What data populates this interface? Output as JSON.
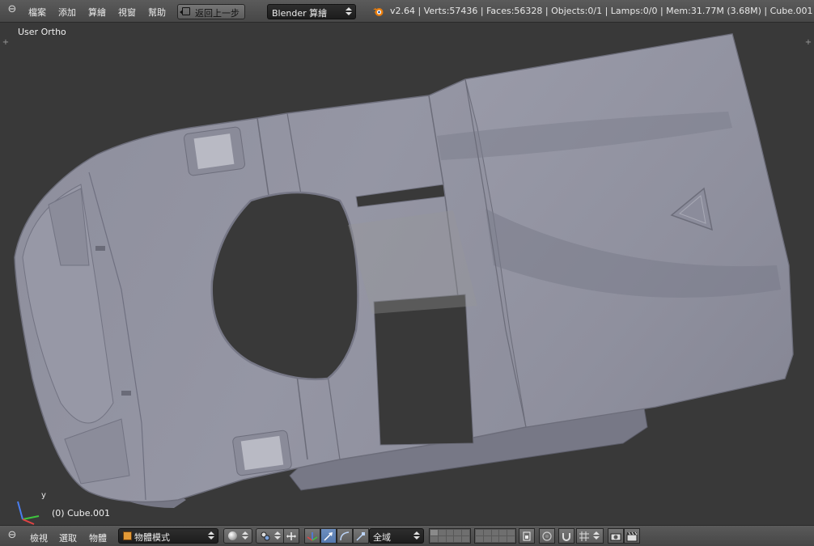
{
  "top_header": {
    "menu": [
      "檔案",
      "添加",
      "算繪",
      "視窗",
      "幫助"
    ],
    "undo_label": "返回上一步",
    "render_engine": "Blender 算繪",
    "stats": "v2.64 | Verts:57436 | Faces:56328 | Objects:0/1 | Lamps:0/0 | Mem:31.77M (3.68M) | Cube.001"
  },
  "viewport": {
    "view_name": "User Ortho",
    "object_label": "(0) Cube.001",
    "axis_y_label": "y"
  },
  "bottom_header": {
    "menu": [
      "檢視",
      "選取",
      "物體"
    ],
    "mode": "物體模式",
    "transform_space": "全域"
  },
  "colors": {
    "viewport_bg": "#393939",
    "mesh": "#8f909c",
    "header": "#4e4e4e",
    "active_tool": "#5478ad"
  }
}
